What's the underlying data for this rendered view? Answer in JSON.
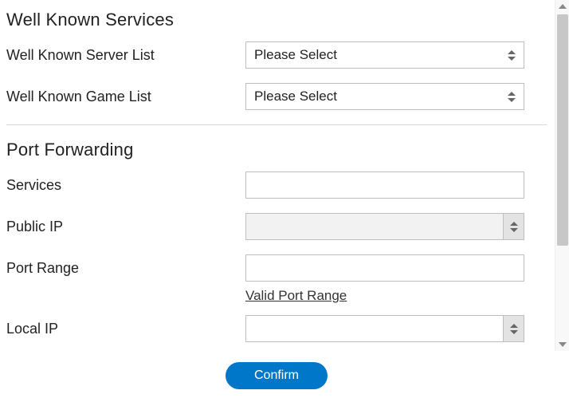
{
  "sections": {
    "wellKnownServices": {
      "title": "Well Known Services",
      "serverList": {
        "label": "Well Known Server List",
        "selected": "Please Select"
      },
      "gameList": {
        "label": "Well Known Game List",
        "selected": "Please Select"
      }
    },
    "portForwarding": {
      "title": "Port Forwarding",
      "services": {
        "label": "Services",
        "value": ""
      },
      "publicIp": {
        "label": "Public IP",
        "value": ""
      },
      "portRange": {
        "label": "Port Range",
        "value": "",
        "helper": "Valid Port Range"
      },
      "localIp": {
        "label": "Local IP",
        "value": ""
      }
    }
  },
  "footer": {
    "confirm": "Confirm"
  }
}
